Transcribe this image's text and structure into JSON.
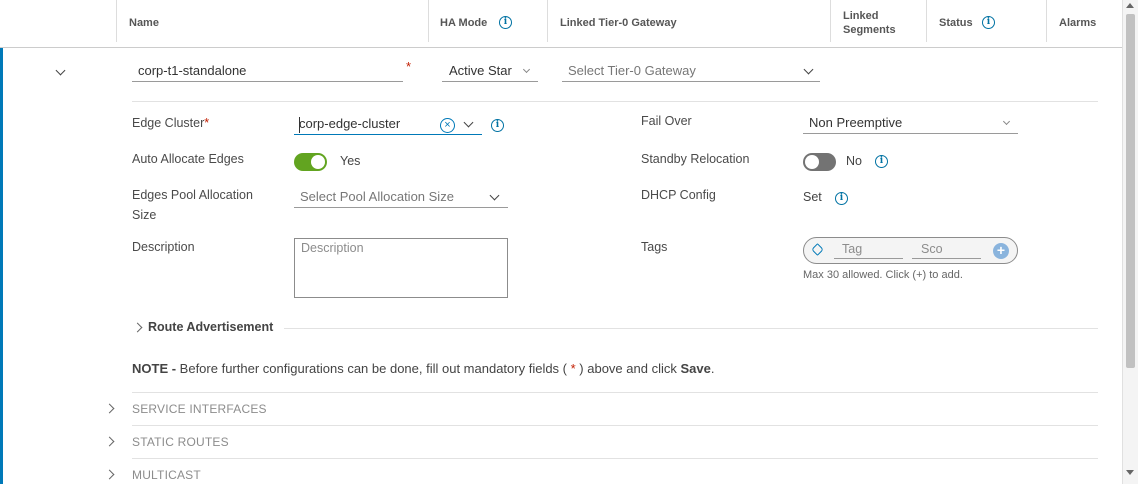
{
  "header": {
    "name": "Name",
    "ha_mode": "HA Mode",
    "linked_t0": "Linked Tier-0 Gateway",
    "linked_segments_l1": "Linked",
    "linked_segments_l2": "Segments",
    "status": "Status",
    "alarms": "Alarms"
  },
  "row": {
    "name_value": "corp-t1-standalone",
    "ha_mode_value": "Active Star",
    "t0_placeholder": "Select Tier-0 Gateway"
  },
  "form": {
    "edge_cluster_label": "Edge Cluster",
    "edge_cluster_value": "corp-edge-cluster",
    "fail_over_label": "Fail Over",
    "fail_over_value": "Non Preemptive",
    "auto_allocate_label": "Auto Allocate Edges",
    "auto_allocate_value": "Yes",
    "standby_label": "Standby Relocation",
    "standby_value": "No",
    "pool_label_l1": "Edges Pool Allocation",
    "pool_label_l2": "Size",
    "pool_placeholder": "Select Pool Allocation Size",
    "dhcp_label": "DHCP Config",
    "dhcp_value": "Set",
    "description_label": "Description",
    "description_placeholder": "Description",
    "tags_label": "Tags",
    "tag_placeholder": "Tag",
    "scope_placeholder": "Sco",
    "tags_hint": "Max 30 allowed. Click (+) to add.",
    "required_mark": "*"
  },
  "route_adv": "Route Advertisement",
  "note": {
    "prefix": "NOTE -",
    "text": " Before further configurations can be done, fill out mandatory fields ( ",
    "star": "*",
    "text2": " ) above and click ",
    "save": "Save",
    "end": "."
  },
  "sections": [
    "SERVICE INTERFACES",
    "STATIC ROUTES",
    "MULTICAST"
  ],
  "colors": {
    "accent": "#0079b8",
    "toggle_on": "#62a420",
    "toggle_off": "#737373",
    "required": "#c21d00"
  }
}
